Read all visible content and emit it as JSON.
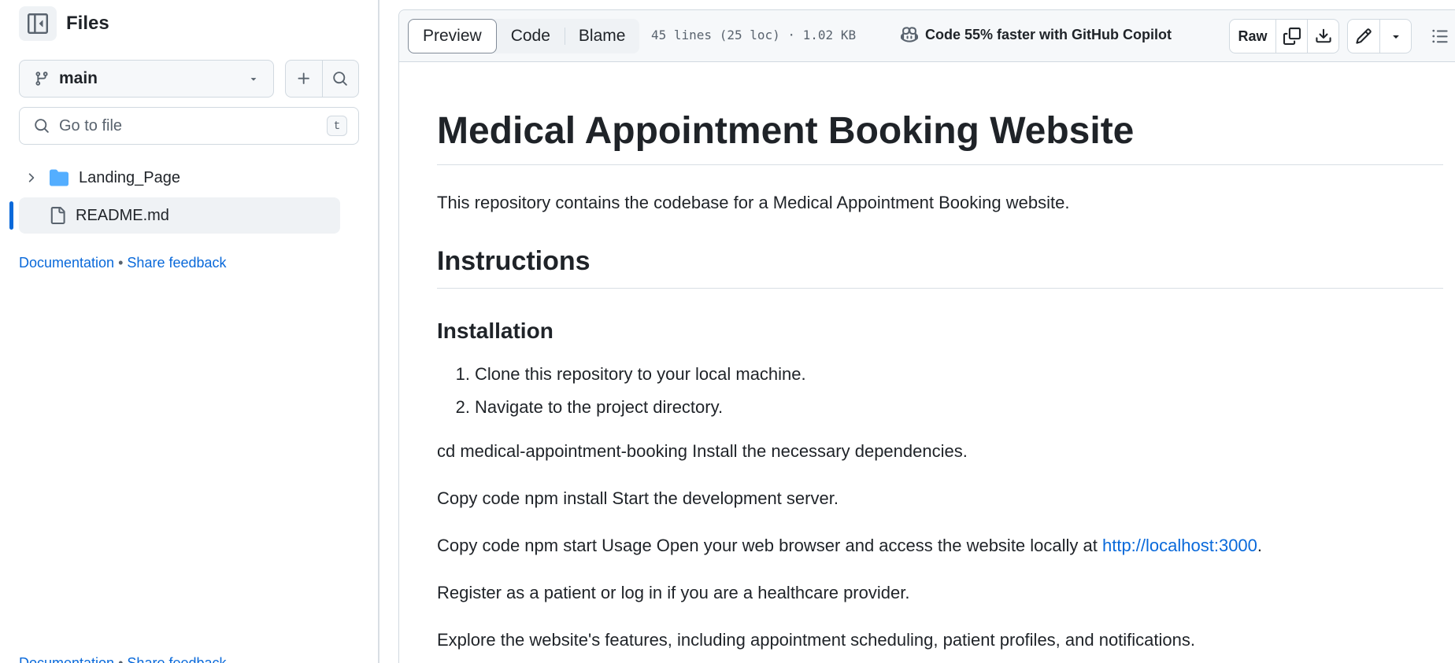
{
  "sidebar": {
    "title": "Files",
    "branch": "main",
    "search_placeholder": "Go to file",
    "search_shortcut": "t",
    "tree": [
      {
        "type": "folder",
        "name": "Landing_Page"
      },
      {
        "type": "file",
        "name": "README.md",
        "selected": true
      }
    ],
    "footer": {
      "documentation": "Documentation",
      "separator": "•",
      "feedback": "Share feedback"
    }
  },
  "toolbar": {
    "tabs": [
      "Preview",
      "Code",
      "Blame"
    ],
    "active_tab": "Preview",
    "file_meta": "45 lines (25 loc) · 1.02 KB",
    "copilot_text": "Code 55% faster with GitHub Copilot",
    "raw_label": "Raw"
  },
  "readme": {
    "title": "Medical Appointment Booking Website",
    "intro": "This repository contains the codebase for a Medical Appointment Booking website.",
    "h_instructions": "Instructions",
    "h_installation": "Installation",
    "steps": [
      {
        "num": "1.",
        "text": "Clone this repository to your local machine."
      },
      {
        "num": "2.",
        "text": "Navigate to the project directory."
      }
    ],
    "p_cd": "cd medical-appointment-booking Install the necessary dependencies.",
    "p_npm_install": "Copy code npm install Start the development server.",
    "p_npm_start_before": "Copy code npm start Usage Open your web browser and access the website locally at ",
    "p_npm_start_link": "http://localhost:3000",
    "p_npm_start_after": ".",
    "p_register": "Register as a patient or log in if you are a healthcare provider.",
    "p_explore": "Explore the website's features, including appointment scheduling, patient profiles, and notifications."
  },
  "colors": {
    "accent": "#0969da",
    "folder": "#54aeff",
    "text": "#1f2328",
    "muted": "#59636e",
    "border": "#d1d9e0"
  }
}
